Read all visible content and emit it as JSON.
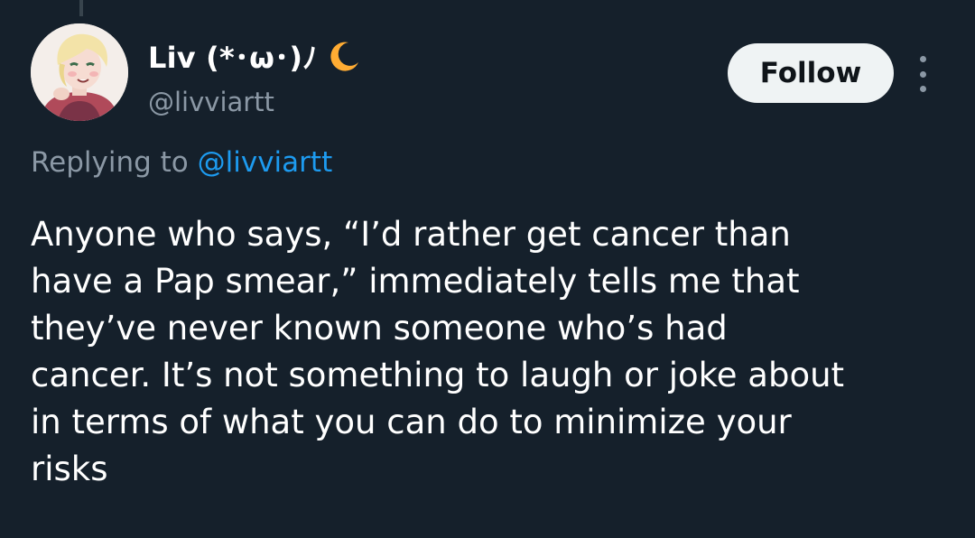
{
  "author": {
    "display_name": "Liv (*･ω･)ﾉ",
    "name_emoji": "crescent-moon",
    "handle": "@livviartt",
    "avatar": "illustrated-portrait"
  },
  "actions": {
    "follow_label": "Follow",
    "more_icon": "vertical-ellipsis"
  },
  "reply_context": {
    "prefix": "Replying to",
    "mention": "@livviartt"
  },
  "tweet": {
    "lines": [
      "Anyone who says, “I’d rather get cancer than",
      "have a Pap smear,” immediately tells me that",
      "they’ve never known someone who’s had",
      "cancer. It’s not something to laugh or joke about",
      "in terms of what you can do to minimize your",
      "risks"
    ]
  },
  "colors": {
    "background": "#15202b",
    "text_primary": "#ffffff",
    "text_secondary": "#8b98a5",
    "link": "#1d9bf0",
    "follow_bg": "#eff3f4",
    "moon": "#ffac33"
  }
}
